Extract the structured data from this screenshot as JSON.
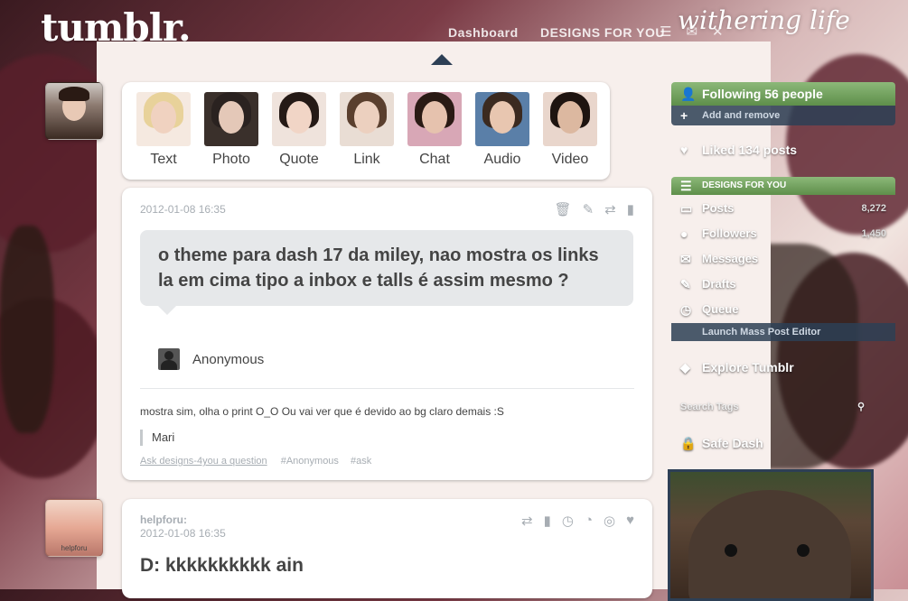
{
  "header": {
    "logo": "tumblr.",
    "signature": "withering life",
    "nav": [
      "Dashboard",
      "DESIGNS FOR YOU"
    ],
    "icons": [
      "home-icon",
      "mail-icon",
      "settings-icon",
      "power-icon"
    ]
  },
  "post_types": [
    {
      "label": "Text",
      "face": "#f0d2c0",
      "hair": "#e8d29a"
    },
    {
      "label": "Photo",
      "face": "#e4c8b8",
      "hair": "#2a2220"
    },
    {
      "label": "Quote",
      "face": "#f1d5c6",
      "hair": "#251a16"
    },
    {
      "label": "Link",
      "face": "#ecd0bf",
      "hair": "#5a3f2e"
    },
    {
      "label": "Chat",
      "face": "#e6c2ae",
      "hair": "#2a1a14"
    },
    {
      "label": "Audio",
      "face": "#e8c6b0",
      "hair": "#3b2a20"
    },
    {
      "label": "Video",
      "face": "#dcb8a0",
      "hair": "#1e1410"
    }
  ],
  "post1": {
    "date": "2012-01-08 16:35",
    "question": "o theme para dash 17 da miley, nao mostra os links la em cima tipo a inbox e talls é assim mesmo ?",
    "asker": "Anonymous",
    "answer": "mostra sim, olha o print O_O Ou vai ver que é devido ao bg claro demais :S",
    "quote": "Mari",
    "ask_link": "Ask designs-4you a question",
    "tags": [
      "#Anonymous",
      "#ask"
    ]
  },
  "post2": {
    "author": "helpforu:",
    "date": "2012-01-08 16:35",
    "title": "D: kkkkkkkkkk ain",
    "avatar_label": "helpforu"
  },
  "sidebar": {
    "following": "Following 56 people",
    "add_remove": "Add and remove",
    "liked": "Liked 134 posts",
    "designs_head": "DESIGNS FOR YOU",
    "items": [
      {
        "label": "Posts",
        "count": "8,272"
      },
      {
        "label": "Followers",
        "count": "1,450"
      },
      {
        "label": "Messages",
        "count": ""
      },
      {
        "label": "Drafts",
        "count": ""
      },
      {
        "label": "Queue",
        "count": ""
      }
    ],
    "launch": "Launch Mass Post Editor",
    "explore": "Explore Tumblr",
    "search": "Search Tags",
    "safe": "Safe Dash"
  },
  "colors": {
    "accent_green": "#6c9c57",
    "navy": "#2d3f55",
    "meta_gray": "#a7adb3",
    "text": "#444444"
  }
}
